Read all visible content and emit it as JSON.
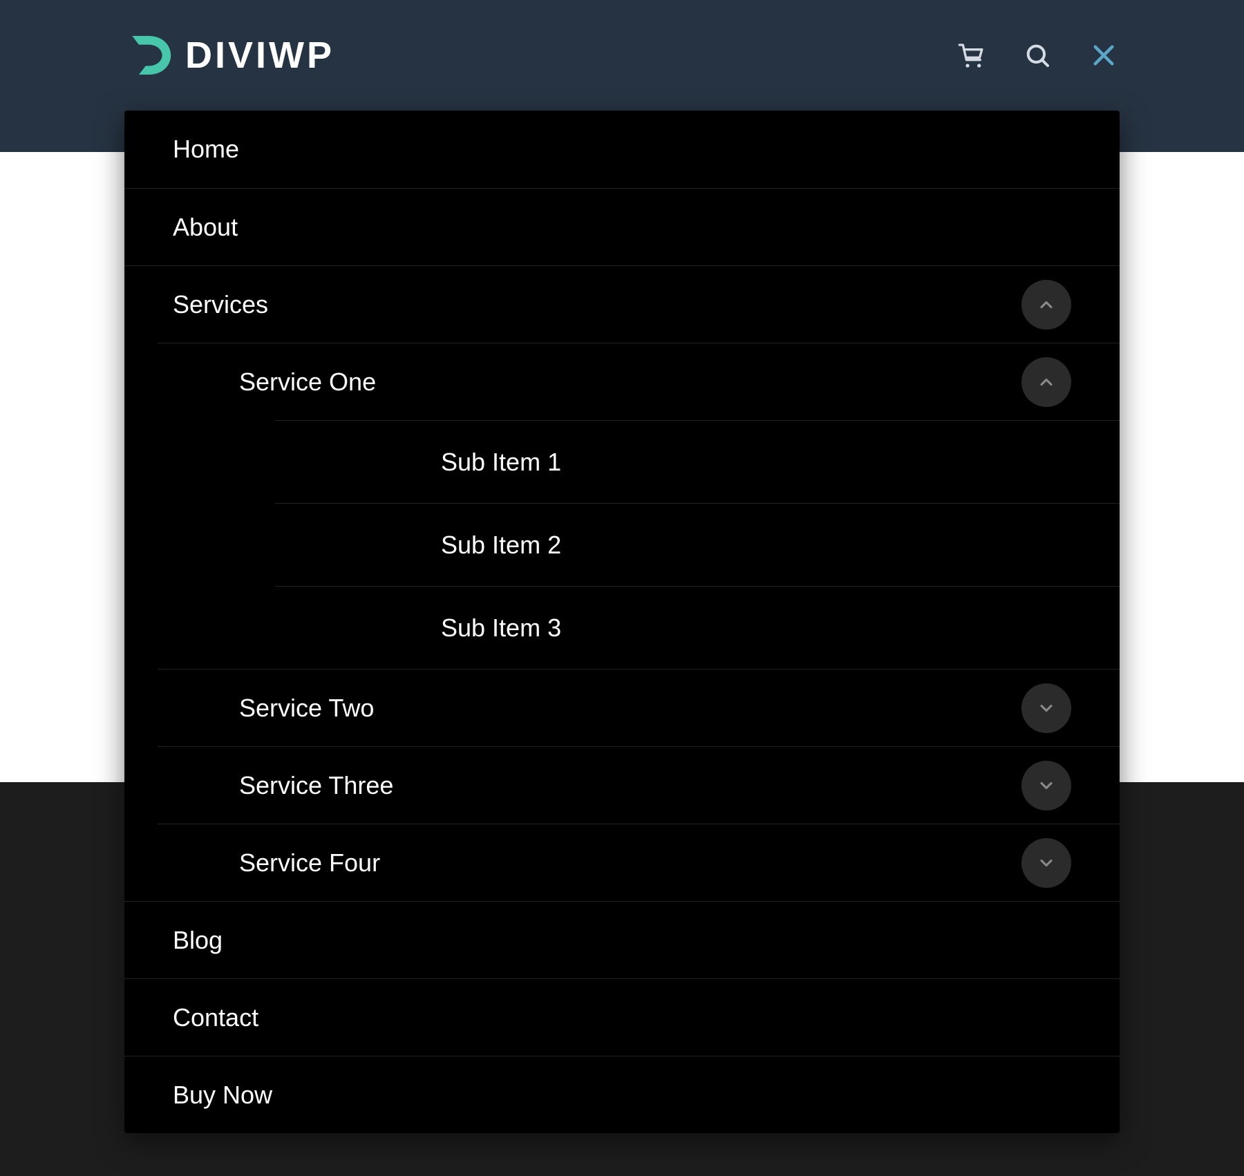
{
  "brand": {
    "name": "DIVIWP",
    "accent": "#47c6ab"
  },
  "header": {
    "icons": {
      "cart": "cart-icon",
      "search": "search-icon",
      "close": "close-icon"
    },
    "close_color": "#5aa7c8"
  },
  "menu": {
    "items": [
      {
        "label": "Home"
      },
      {
        "label": "About"
      },
      {
        "label": "Services",
        "expanded": true,
        "children_key": "services"
      },
      {
        "label": "Blog"
      },
      {
        "label": "Contact"
      },
      {
        "label": "Buy Now"
      }
    ],
    "services": [
      {
        "label": "Service One",
        "expanded": true,
        "children_key": "service_one_subs"
      },
      {
        "label": "Service Two",
        "expanded": false
      },
      {
        "label": "Service Three",
        "expanded": false
      },
      {
        "label": "Service Four",
        "expanded": false
      }
    ],
    "service_one_subs": [
      {
        "label": "Sub Item 1"
      },
      {
        "label": "Sub Item 2"
      },
      {
        "label": "Sub Item 3"
      }
    ]
  }
}
